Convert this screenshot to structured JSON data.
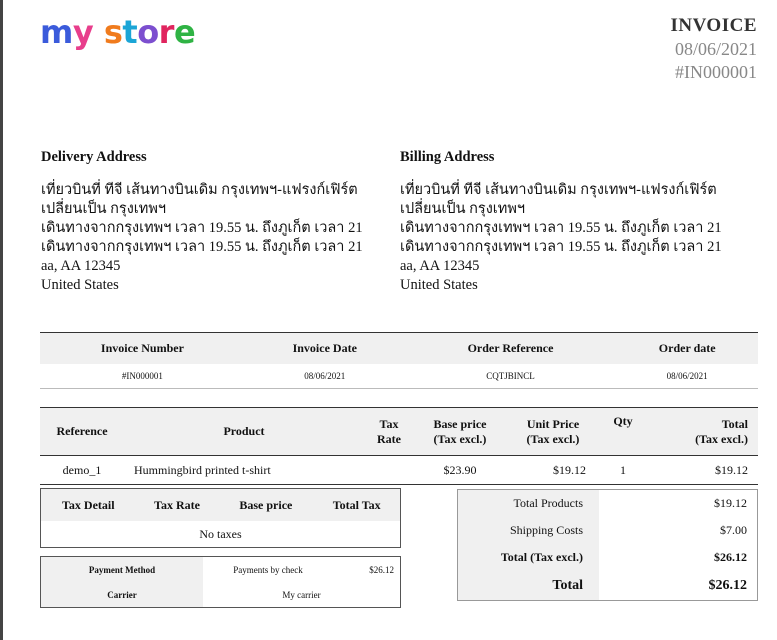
{
  "logo": {
    "letters": [
      "m",
      "y",
      " ",
      "s",
      "t",
      "o",
      "r",
      "e"
    ],
    "colors": [
      "#3b5bdb",
      "#e83e8c",
      "#fff",
      "#f07b1d",
      "#1ba5d6",
      "#7c4fcf",
      "#e0245e",
      "#2fb344"
    ]
  },
  "invoice": {
    "title": "INVOICE",
    "date": "08/06/2021",
    "number": "#IN000001"
  },
  "delivery": {
    "heading": "Delivery Address",
    "lines": [
      "เที่ยวบินที่ ทีจี เส้นทางบินเดิม กรุงเทพฯ-แฟรงก์เฟิร์ต",
      "เปลี่ยนเป็น กรุงเทพฯ",
      "เดินทางจากกรุงเทพฯ เวลา 19.55 น. ถึงภูเก็ต เวลา 21",
      "เดินทางจากกรุงเทพฯ เวลา 19.55 น. ถึงภูเก็ต เวลา 21",
      "aa, AA 12345",
      "United States"
    ]
  },
  "billing": {
    "heading": "Billing Address",
    "lines": [
      "เที่ยวบินที่ ทีจี เส้นทางบินเดิม กรุงเทพฯ-แฟรงก์เฟิร์ต",
      "เปลี่ยนเป็น กรุงเทพฯ",
      "เดินทางจากกรุงเทพฯ เวลา 19.55 น. ถึงภูเก็ต เวลา 21",
      "เดินทางจากกรุงเทพฯ เวลา 19.55 น. ถึงภูเก็ต เวลา 21",
      "aa, AA 12345",
      "United States"
    ]
  },
  "summary": {
    "headers": [
      "Invoice Number",
      "Invoice Date",
      "Order Reference",
      "Order date"
    ],
    "values": [
      "#IN000001",
      "08/06/2021",
      "CQTJBINCL",
      "08/06/2021"
    ]
  },
  "products": {
    "headers": {
      "reference": "Reference",
      "product": "Product",
      "tax_rate_1": "Tax",
      "tax_rate_2": "Rate",
      "base_1": "Base price",
      "base_2": "(Tax excl.)",
      "unit_1": "Unit Price",
      "unit_2": "(Tax excl.)",
      "qty": "Qty",
      "total_1": "Total",
      "total_2": "(Tax excl.)"
    },
    "rows": [
      {
        "reference": "demo_1",
        "product": "Hummingbird printed t-shirt",
        "tax_rate": "",
        "base": "$23.90",
        "unit": "$19.12",
        "qty": "1",
        "total": "$19.12"
      }
    ]
  },
  "tax": {
    "headers": [
      "Tax Detail",
      "Tax Rate",
      "Base price",
      "Total Tax"
    ],
    "empty": "No taxes"
  },
  "payment": {
    "method_label": "Payment Method",
    "method_value": "Payments by check",
    "amount": "$26.12",
    "carrier_label": "Carrier",
    "carrier_value": "My carrier"
  },
  "totals": {
    "products_label": "Total Products",
    "products_value": "$19.12",
    "shipping_label": "Shipping Costs",
    "shipping_value": "$7.00",
    "taxexcl_label": "Total (Tax excl.)",
    "taxexcl_value": "$26.12",
    "total_label": "Total",
    "total_value": "$26.12"
  }
}
